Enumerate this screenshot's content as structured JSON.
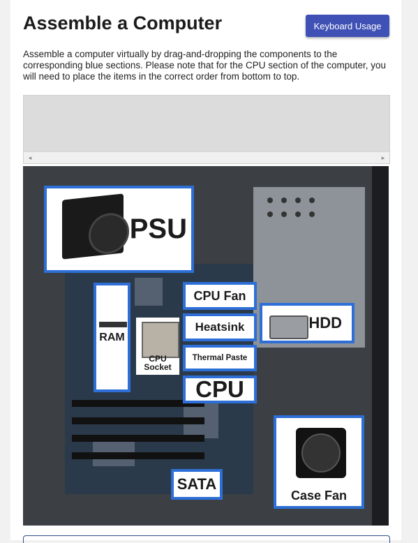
{
  "header": {
    "title": "Assemble a Computer",
    "keyboard_button": "Keyboard Usage"
  },
  "description": "Assemble a computer virtually by drag-and-dropping the components to the corresponding blue sections. Please note that for the CPU section of the computer, you will need to place the items in the correct order from bottom to top.",
  "tray": {
    "scroll_left": "◂",
    "scroll_right": "▸"
  },
  "zones": {
    "psu": "PSU",
    "ram": "RAM",
    "cpu_socket_line1": "CPU",
    "cpu_socket_line2": "Socket",
    "cpu_fan": "CPU Fan",
    "heatsink": "Heatsink",
    "thermal_paste": "Thermal Paste",
    "cpu": "CPU",
    "hdd": "HDD",
    "sata": "SATA",
    "case_fan": "Case Fan"
  },
  "colors": {
    "accent": "#3f51b5",
    "zone_border": "#2d6fd6"
  }
}
